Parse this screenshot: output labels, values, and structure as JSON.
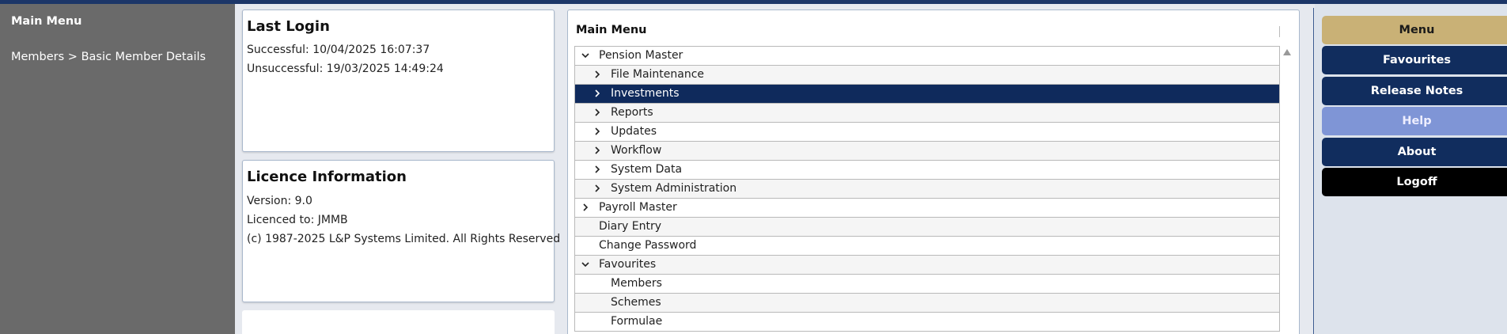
{
  "sidebar": {
    "title": "Main Menu",
    "breadcrumb": "Members > Basic Member Details"
  },
  "last_login": {
    "title": "Last Login",
    "successful": "Successful: 10/04/2025 16:07:37",
    "unsuccessful": "Unsuccessful: 19/03/2025 14:49:24"
  },
  "licence": {
    "title": "Licence Information",
    "version": "Version: 9.0",
    "licenced_to": "Licenced to: JMMB",
    "copyright": "(c) 1987-2025 L&P Systems Limited. All Rights Reserved"
  },
  "main_menu": {
    "title": "Main Menu",
    "items": [
      {
        "label": "Pension Master",
        "level": 0,
        "icon": "chevron-down-icon",
        "selected": false
      },
      {
        "label": "File Maintenance",
        "level": 1,
        "icon": "chevron-right-icon",
        "selected": false
      },
      {
        "label": "Investments",
        "level": 1,
        "icon": "chevron-right-icon",
        "selected": true
      },
      {
        "label": "Reports",
        "level": 1,
        "icon": "chevron-right-icon",
        "selected": false
      },
      {
        "label": "Updates",
        "level": 1,
        "icon": "chevron-right-icon",
        "selected": false
      },
      {
        "label": "Workflow",
        "level": 1,
        "icon": "chevron-right-icon",
        "selected": false
      },
      {
        "label": "System Data",
        "level": 1,
        "icon": "chevron-right-icon",
        "selected": false
      },
      {
        "label": "System Administration",
        "level": 1,
        "icon": "chevron-right-icon",
        "selected": false
      },
      {
        "label": "Payroll Master",
        "level": 0,
        "icon": "chevron-right-icon",
        "selected": false
      },
      {
        "label": "Diary Entry",
        "level": 0,
        "icon": "",
        "selected": false
      },
      {
        "label": "Change Password",
        "level": 0,
        "icon": "",
        "selected": false
      },
      {
        "label": "Favourites",
        "level": 0,
        "icon": "chevron-down-icon",
        "selected": false
      },
      {
        "label": "Members",
        "level": 1,
        "icon": "",
        "selected": false
      },
      {
        "label": "Schemes",
        "level": 1,
        "icon": "",
        "selected": false
      },
      {
        "label": "Formulae",
        "level": 1,
        "icon": "",
        "selected": false
      }
    ]
  },
  "right_nav": {
    "menu": "Menu",
    "favourites": "Favourites",
    "release_notes": "Release Notes",
    "help": "Help",
    "about": "About",
    "logoff": "Logoff"
  },
  "colors": {
    "navy": "#112d5e",
    "gold": "#c9b176",
    "help_blue": "#7f95d6",
    "sidebar_grey": "#6a6a6a",
    "selected_row": "#0f2a5c"
  }
}
